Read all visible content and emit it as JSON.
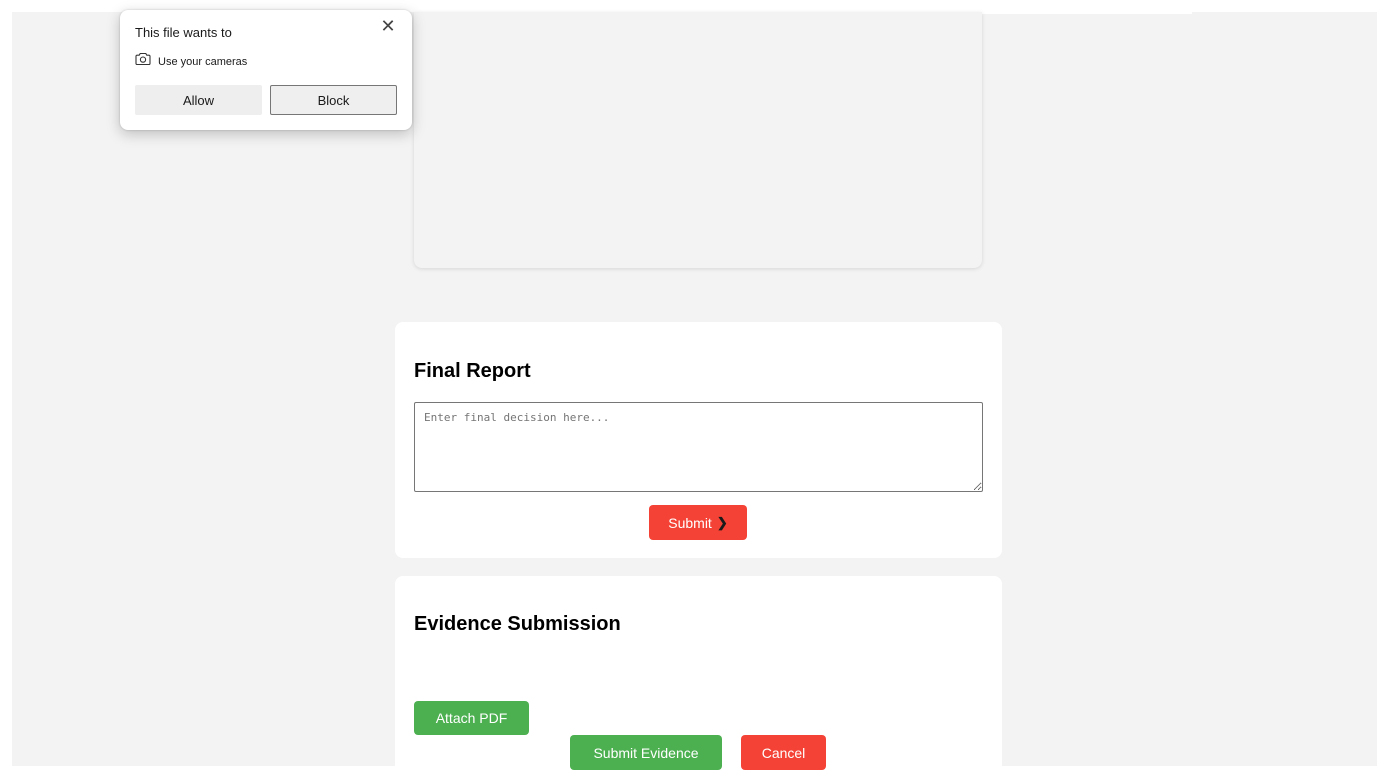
{
  "permission_popup": {
    "title": "This file wants to",
    "permission_label": "Use your cameras",
    "allow_label": "Allow",
    "block_label": "Block",
    "close_glyph": "✕",
    "permission_icon": "camera-icon"
  },
  "final_report": {
    "title": "Final Report",
    "placeholder": "Enter final decision here...",
    "submit_label": "Submit",
    "submit_icon": "chevron-right-icon"
  },
  "evidence_submission": {
    "title": "Evidence Submission",
    "attach_label": "Attach PDF",
    "submit_label": "Submit Evidence",
    "cancel_label": "Cancel"
  },
  "colors": {
    "page_background": "#f3f3f3",
    "card_background": "#ffffff",
    "danger": "#f44336",
    "success": "#4caf50"
  }
}
